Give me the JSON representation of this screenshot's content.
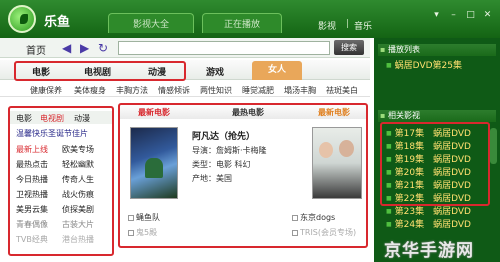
{
  "app": {
    "name": "乐鱼"
  },
  "top_tabs": [
    "影视大全",
    "正在播放"
  ],
  "top_links": [
    "影视",
    "音乐"
  ],
  "window_buttons": [
    "▾",
    "–",
    "□",
    "✕"
  ],
  "nav": {
    "home": "首页",
    "search_label": "搜索",
    "url_value": ""
  },
  "categories": [
    "电影",
    "电视剧",
    "动漫",
    "游戏",
    "女人"
  ],
  "active_category": "女人",
  "subtags": [
    "健康保养",
    "美体瘦身",
    "丰胸方法",
    "情感倾诉",
    "两性知识",
    "睡觉减肥",
    "塌汤丰胸",
    "祛斑美白"
  ],
  "left_panel": {
    "tabs": [
      "电影",
      "电视剧",
      "动漫"
    ],
    "rows": [
      [
        "温馨快乐圣诞节佳片",
        ""
      ],
      [
        "最新上线",
        "欧美专场"
      ],
      [
        "最热点击",
        "轻松幽默"
      ],
      [
        "今日热播",
        "传奇人生"
      ],
      [
        "卫视热播",
        "战火伤痕"
      ],
      [
        "美男云集",
        "侦探美剧"
      ],
      [
        "青春偶像",
        "古装大片"
      ],
      [
        "TVB经典",
        "港台热播"
      ]
    ]
  },
  "main_panel": {
    "headers": [
      "最新电影",
      "最热电影",
      "最新电影"
    ],
    "movie_title": "阿凡达（抢先）",
    "info": [
      "导演：詹姆斯·卡梅隆",
      "类型：电影 科幻",
      "产地：美国"
    ],
    "links": [
      "蝇鱼队",
      "东京dogs",
      "鬼5殿",
      "TRIS(会员专场)"
    ]
  },
  "right_panel": {
    "playlist_title": "播放列表",
    "playing": "蜗居DVD第25集",
    "related_title": "相关影视",
    "related": [
      "第17集　蜗居DVD",
      "第18集　蜗居DVD",
      "第19集　蜗居DVD",
      "第20集　蜗居DVD",
      "第21集　蜗居DVD",
      "第22集　蜗居DVD",
      "第23集　蜗居DVD",
      "第24集　蜗居DVD"
    ]
  },
  "watermark": "京华手游网"
}
